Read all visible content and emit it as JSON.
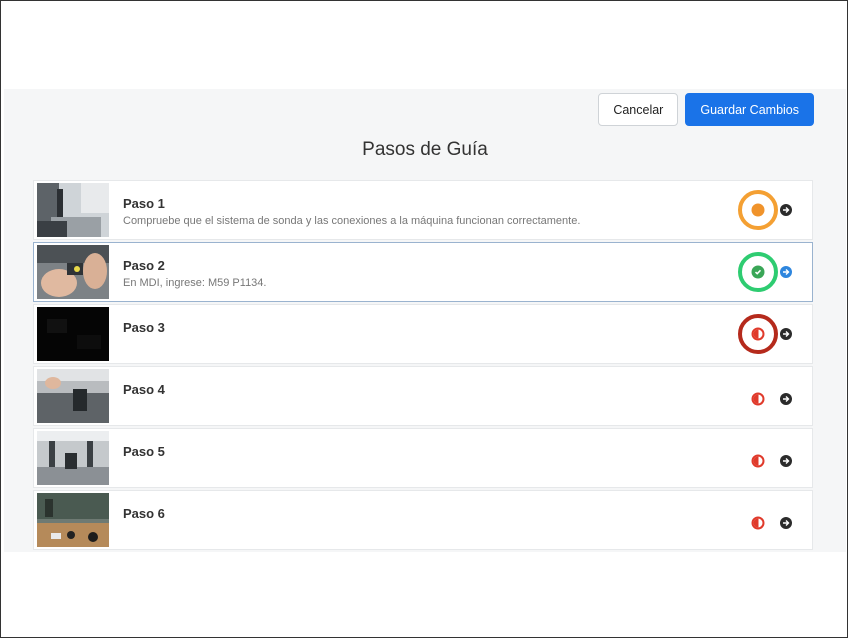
{
  "toolbar": {
    "cancel_label": "Cancelar",
    "save_label": "Guardar Cambios"
  },
  "page_title": "Pasos de Guía",
  "colors": {
    "accent": "#1a73e8",
    "in_progress": "#f0932b",
    "done": "#3aa657",
    "partial": "#e03a2b",
    "ring_orange": "#f4a033",
    "ring_green": "#2ecc71",
    "ring_red": "#b52a1c"
  },
  "steps": [
    {
      "title": "Paso 1",
      "description": "Compruebe que el sistema de sonda y las conexiones a la máquina funcionan correctamente.",
      "status_icon": "in-progress-dot-icon",
      "highlight": "orange"
    },
    {
      "title": "Paso 2",
      "description": "En MDI, ingrese: M59 P1134.",
      "status_icon": "check-circle-icon",
      "highlight": "green"
    },
    {
      "title": "Paso 3",
      "description": "",
      "status_icon": "half-circle-icon",
      "highlight": "red"
    },
    {
      "title": "Paso 4",
      "description": "",
      "status_icon": "half-circle-icon",
      "highlight": ""
    },
    {
      "title": "Paso 5",
      "description": "",
      "status_icon": "half-circle-icon",
      "highlight": ""
    },
    {
      "title": "Paso 6",
      "description": "",
      "status_icon": "half-circle-icon",
      "highlight": ""
    }
  ]
}
